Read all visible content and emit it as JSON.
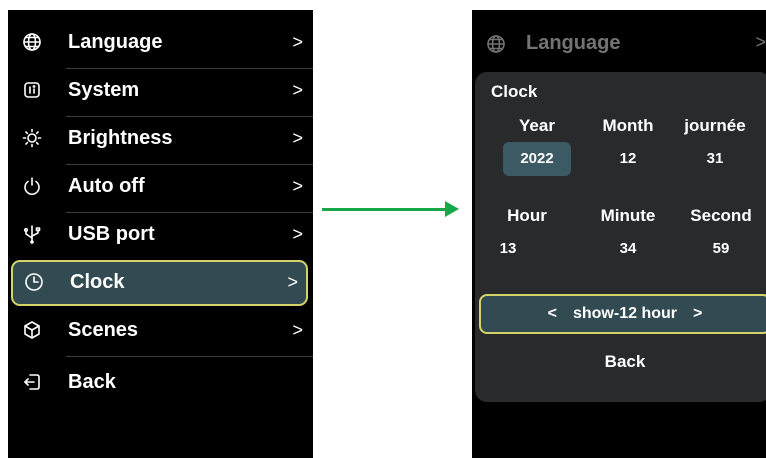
{
  "left_menu": {
    "items": [
      {
        "label": "Language",
        "icon": "globe-icon"
      },
      {
        "label": "System",
        "icon": "system-icon"
      },
      {
        "label": "Brightness",
        "icon": "brightness-icon"
      },
      {
        "label": "Auto off",
        "icon": "power-icon"
      },
      {
        "label": "USB port",
        "icon": "usb-icon"
      },
      {
        "label": "Clock",
        "icon": "clock-icon",
        "selected": true
      },
      {
        "label": "Scenes",
        "icon": "scenes-icon"
      },
      {
        "label": "Back",
        "icon": "back-icon"
      }
    ],
    "chevron": ">"
  },
  "right_screen": {
    "header": {
      "label": "Language",
      "chevron": ">"
    },
    "clock": {
      "title": "Clock",
      "date_headers": [
        "Year",
        "Month",
        "journée"
      ],
      "date_values": [
        "2022",
        "12",
        "31"
      ],
      "time_headers": [
        "Hour",
        "Minute",
        "Second"
      ],
      "time_values": [
        "13",
        "34",
        "59"
      ],
      "toggle": {
        "left": "<",
        "label": "show-12 hour",
        "right": ">"
      },
      "back_label": "Back"
    }
  },
  "colors": {
    "background": "#000000",
    "selected_fill": "#324b52",
    "selected_border": "#d4d36b",
    "arrow": "#17a84a",
    "panel": "#282a2c"
  }
}
